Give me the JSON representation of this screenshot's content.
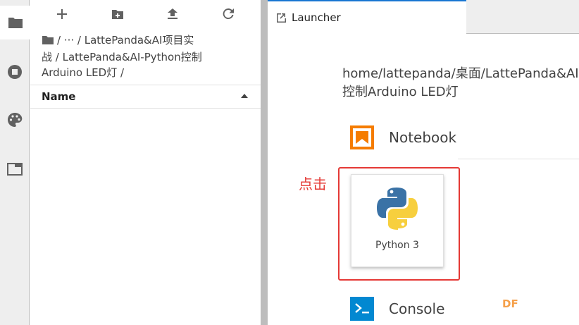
{
  "activity_bar": {
    "items": [
      {
        "icon": "folder-icon"
      },
      {
        "icon": "stop-circle-icon"
      },
      {
        "icon": "palette-icon"
      },
      {
        "icon": "tab-icon"
      }
    ]
  },
  "file_browser": {
    "toolbar": [
      "new-launcher-icon",
      "new-folder-icon",
      "upload-icon",
      "refresh-icon"
    ],
    "breadcrumb": {
      "line1": "/ ··· / LattePanda&AI项目实",
      "line2": "战 / LattePanda&AI-Python控制",
      "line3": "Arduino LED灯 /"
    },
    "column_header": "Name"
  },
  "main": {
    "tab_label": "Launcher",
    "path_line1": "home/lattepanda/桌面/LattePanda&AI",
    "path_line2": "控制Arduino LED灯",
    "sections": {
      "notebook": "Notebook",
      "console": "Console"
    },
    "kernel_card": {
      "label": "Python 3",
      "icon": "python-logo-icon"
    },
    "annotation": "点击",
    "watermark": "DF"
  },
  "colors": {
    "accent": "#1976d2",
    "annotation_red": "#e53935",
    "notebook_orange": "#f57c00",
    "console_blue": "#0288d1"
  }
}
